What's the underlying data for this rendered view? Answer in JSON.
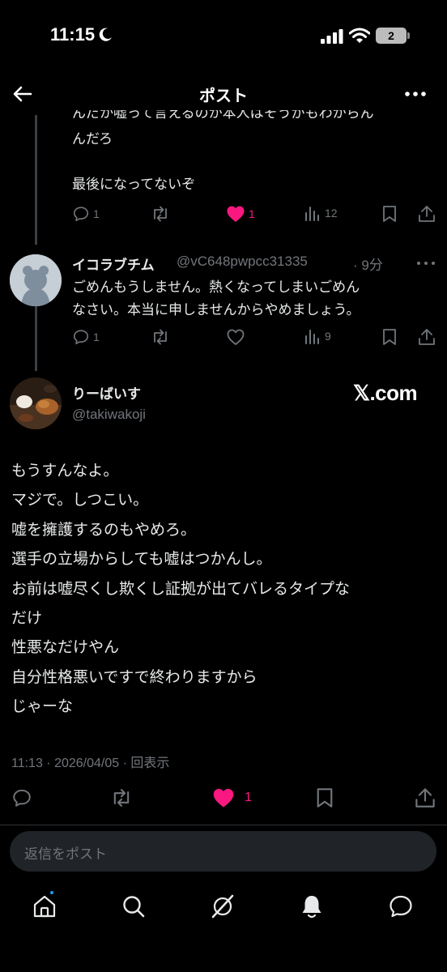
{
  "status": {
    "time": "11:15",
    "battery": "2"
  },
  "header": {
    "title": "ポスト"
  },
  "thread": {
    "cut_line": "んだか嘘って言えるのか本人はそうがもわからん",
    "prev_reply": {
      "lines": [
        "んだろ",
        "",
        "最後になってないぞ"
      ],
      "counts": {
        "reply": "1",
        "repost": "",
        "like": "1",
        "views": "12"
      }
    },
    "reply2": {
      "name": "イコラブチム",
      "handle": "@vC648pwpcc31335",
      "time": "· 9分",
      "lines": [
        "ごめんもうしません。熱くなってしまいごめん",
        "なさい。本当に申しませんからやめましょう。"
      ],
      "counts": {
        "reply": "1",
        "repost": "",
        "like": "",
        "views": "9"
      }
    }
  },
  "main_post": {
    "name": "りーばいす",
    "handle": "@takiwakoji",
    "watermark": "𝕏.com",
    "lines": [
      "もうすんなよ。",
      "マジで。しつこい。",
      "嘘を擁護するのもやめろ。",
      "選手の立場からしても嘘はつかんし。",
      "お前は嘘尽くし欺くし証拠が出てバレるタイプな",
      "だけ",
      "性悪なだけやん",
      "自分性格悪いですで終わりますから",
      "じゃーな"
    ],
    "timestamp": "11:13 · 2026/04/05 · 回表示",
    "counts": {
      "like": "1"
    }
  },
  "reply_box": {
    "placeholder": "返信をポスト"
  },
  "colors": {
    "like": "#f91880",
    "muted": "#71767b",
    "accent": "#1d9bf0"
  },
  "icons": [
    "back-arrow-icon",
    "more-icon",
    "reply-icon",
    "repost-icon",
    "heart-icon",
    "views-icon",
    "bookmark-icon",
    "share-icon",
    "home-icon",
    "search-icon",
    "grok-icon",
    "bell-icon",
    "messages-icon"
  ]
}
